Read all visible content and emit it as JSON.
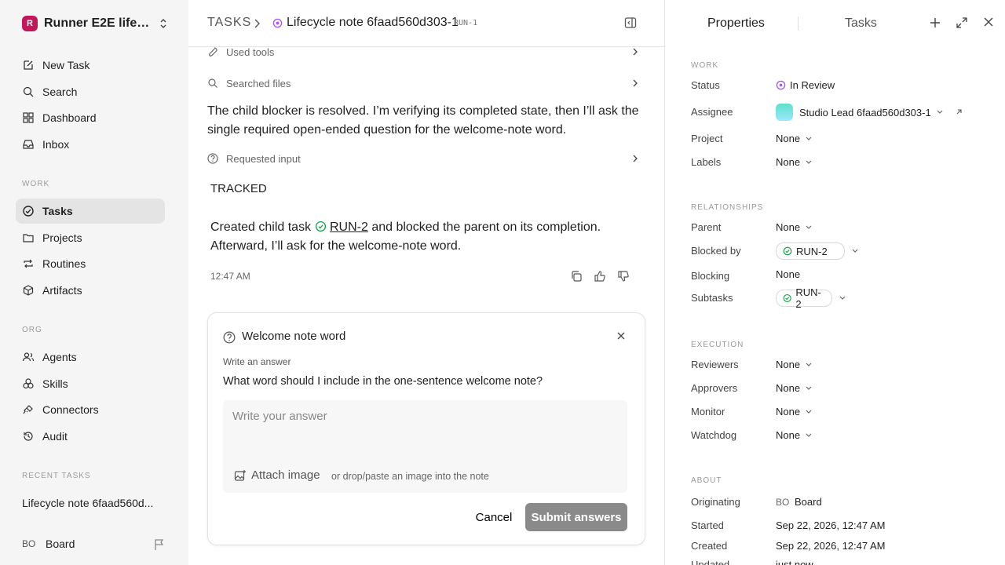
{
  "sidebar": {
    "workspace": {
      "logo_letter": "R",
      "name": "Runner E2E lifecy..."
    },
    "nav": [
      {
        "label": "New Task",
        "icon": "edit-icon"
      },
      {
        "label": "Search",
        "icon": "search-icon"
      },
      {
        "label": "Dashboard",
        "icon": "dashboard-icon"
      },
      {
        "label": "Inbox",
        "icon": "inbox-icon"
      }
    ],
    "work_label": "WORK",
    "work": [
      {
        "label": "Tasks",
        "icon": "check-circle-icon",
        "active": true
      },
      {
        "label": "Projects",
        "icon": "folder-icon"
      },
      {
        "label": "Routines",
        "icon": "repeat-icon"
      },
      {
        "label": "Artifacts",
        "icon": "cube-icon"
      }
    ],
    "org_label": "ORG",
    "org": [
      {
        "label": "Agents",
        "icon": "users-icon"
      },
      {
        "label": "Skills",
        "icon": "skills-icon"
      },
      {
        "label": "Connectors",
        "icon": "plug-icon"
      },
      {
        "label": "Audit",
        "icon": "history-icon"
      }
    ],
    "recent_label": "RECENT TASKS",
    "recent_item": "Lifecycle note 6faad560d...",
    "user": {
      "initials": "BO",
      "name": "Board"
    }
  },
  "header": {
    "root": "TASKS",
    "title": "Lifecycle note 6faad560d303-1",
    "task_id": "RUN-1"
  },
  "thread": {
    "used_tools": "Used tools",
    "searched_files": "Searched files",
    "message": "The child blocker is resolved. I’m verifying its completed state, then I’ll ask the single required open-ended question for the welcome-note word.",
    "requested_input": "Requested input",
    "tracked": "TRACKED",
    "created_before": "Created child task",
    "created_link": "RUN-2",
    "created_after": "and blocked the parent on its completion.",
    "created_line2": "Afterward, I’ll ask for the welcome-note word.",
    "time": "12:47 AM"
  },
  "question": {
    "title": "Welcome note word",
    "hint": "Write an answer",
    "question": "What word should I include in the one-sentence welcome note?",
    "placeholder": "Write your answer",
    "attach": "Attach image",
    "drop_hint": "or drop/paste an image into the note",
    "cancel": "Cancel",
    "submit": "Submit answers"
  },
  "panel": {
    "tab_properties": "Properties",
    "tab_tasks": "Tasks",
    "work_label": "WORK",
    "status_label": "Status",
    "status_value": "In Review",
    "assignee_label": "Assignee",
    "assignee_value": "Studio Lead 6faad560d303-1",
    "project_label": "Project",
    "project_value": "None",
    "labels_label": "Labels",
    "labels_value": "None",
    "relationships_label": "RELATIONSHIPS",
    "parent_label": "Parent",
    "parent_value": "None",
    "blocked_by_label": "Blocked by",
    "blocked_by_value": "RUN-2",
    "blocking_label": "Blocking",
    "blocking_value": "None",
    "subtasks_label": "Subtasks",
    "subtasks_value": "RUN-2",
    "execution_label": "EXECUTION",
    "reviewers_label": "Reviewers",
    "reviewers_value": "None",
    "approvers_label": "Approvers",
    "approvers_value": "None",
    "monitor_label": "Monitor",
    "monitor_value": "None",
    "watchdog_label": "Watchdog",
    "watchdog_value": "None",
    "about_label": "ABOUT",
    "originating_label": "Originating",
    "originating_initials": "BO",
    "originating_value": "Board",
    "started_label": "Started",
    "started_value": "Sep 22, 2026, 12:47 AM",
    "created_label": "Created",
    "created_value": "Sep 22, 2026, 12:47 AM",
    "updated_label": "Updated",
    "updated_value": "just now"
  },
  "colors": {
    "accent_purple": "#a855f7",
    "done_green": "#16a34a",
    "logo": "#c2185b"
  }
}
